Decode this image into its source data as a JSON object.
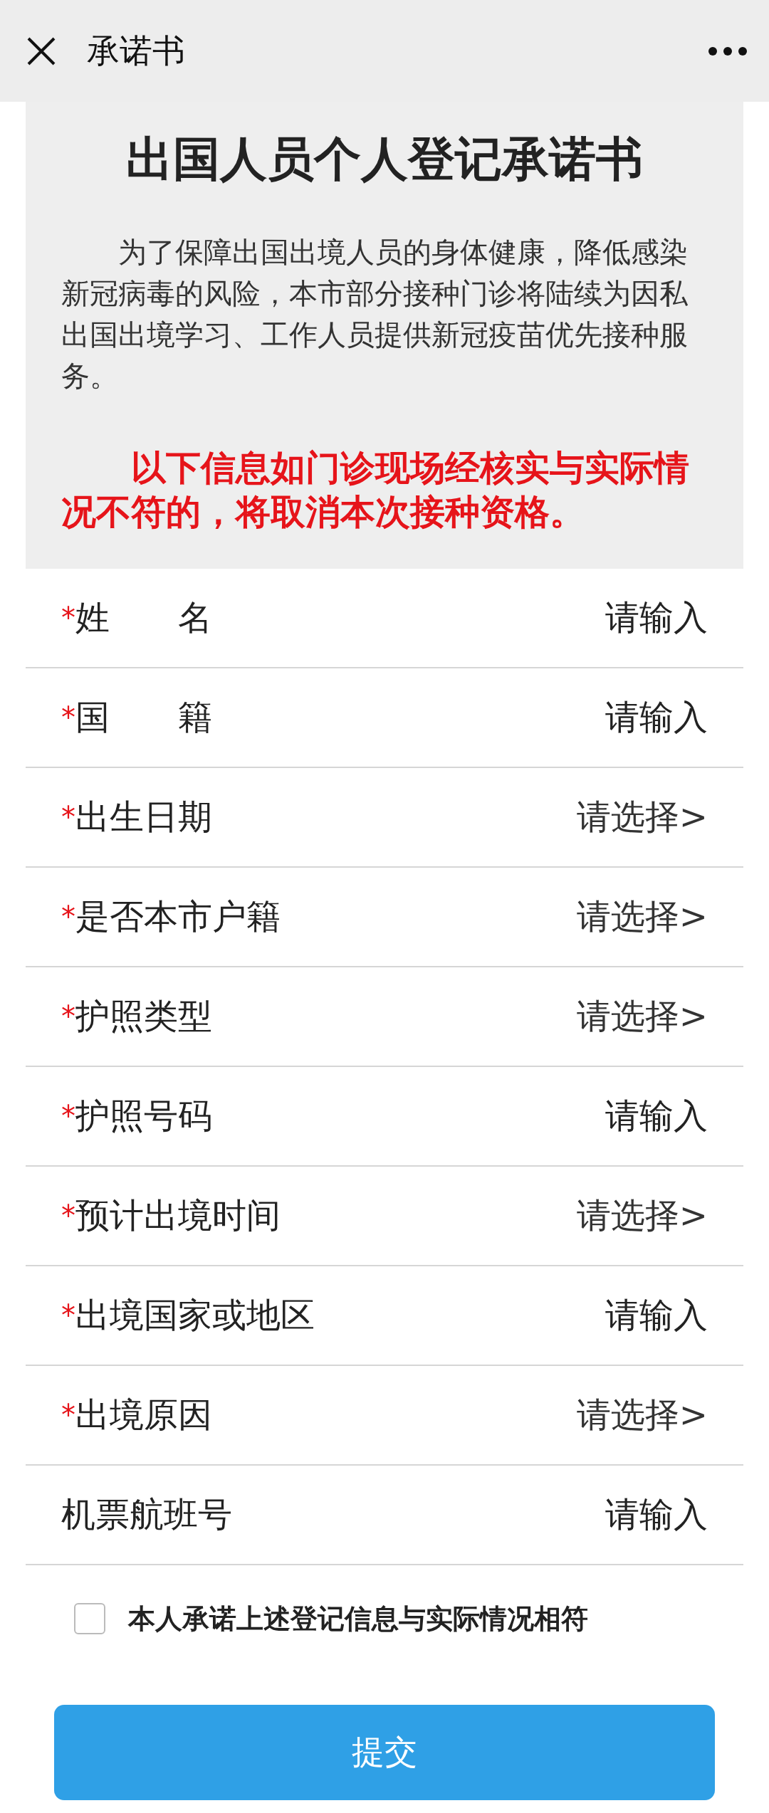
{
  "top_bar": {
    "title": "承诺书"
  },
  "notice": {
    "title": "出国人员个人登记承诺书",
    "intro": "为了保障出国出境人员的身体健康，降低感染新冠病毒的风险，本市部分接种门诊将陆续为因私出国出境学习、工作人员提供新冠疫苗优先接种服务。",
    "warning": "以下信息如门诊现场经核实与实际情况不符的，将取消本次接种资格。"
  },
  "fields": [
    {
      "required_mark": "*",
      "label": "姓　　名",
      "kind": "input",
      "placeholder": "请输入"
    },
    {
      "required_mark": "*",
      "label": "国　　籍",
      "kind": "input",
      "placeholder": "请输入"
    },
    {
      "required_mark": "*",
      "label": "出生日期",
      "kind": "select",
      "placeholder": "请选择>"
    },
    {
      "required_mark": "*",
      "label": "是否本市户籍",
      "kind": "select",
      "placeholder": "请选择>"
    },
    {
      "required_mark": "*",
      "label": "护照类型",
      "kind": "select",
      "placeholder": "请选择>"
    },
    {
      "required_mark": "*",
      "label": "护照号码",
      "kind": "input",
      "placeholder": "请输入"
    },
    {
      "required_mark": "*",
      "label": "预计出境时间",
      "kind": "select",
      "placeholder": "请选择>"
    },
    {
      "required_mark": "*",
      "label": "出境国家或地区",
      "kind": "input",
      "placeholder": "请输入"
    },
    {
      "required_mark": "*",
      "label": "出境原因",
      "kind": "select",
      "placeholder": "请选择>"
    },
    {
      "label": "机票航班号",
      "kind": "input",
      "placeholder": "请输入"
    }
  ],
  "pledge": {
    "label": "本人承诺上述登记信息与实际情况相符",
    "checked": false
  },
  "submit_button": "提交"
}
